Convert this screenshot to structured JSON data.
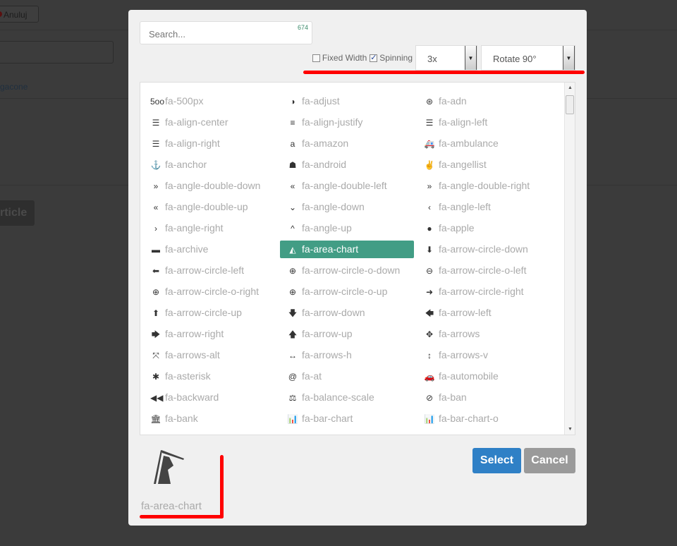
{
  "background": {
    "cancel_label": "Anuluj",
    "link_fragment": "gacone",
    "article_fragment": "rticle"
  },
  "modal": {
    "search": {
      "placeholder": "Search...",
      "count": "674"
    },
    "options": {
      "fixed_width_label": "Fixed Width",
      "fixed_width_checked": false,
      "spinning_label": "Spinning",
      "spinning_checked": true,
      "size_value": "3x",
      "rotate_value": "Rotate 90°"
    },
    "selected": "fa-area-chart",
    "icons": [
      {
        "glyph": "5oo",
        "label": "fa-500px"
      },
      {
        "glyph": "◑",
        "label": "fa-adjust"
      },
      {
        "glyph": "⊛",
        "label": "fa-adn"
      },
      {
        "glyph": "☰",
        "label": "fa-align-center"
      },
      {
        "glyph": "≡",
        "label": "fa-align-justify"
      },
      {
        "glyph": "☰",
        "label": "fa-align-left"
      },
      {
        "glyph": "☰",
        "label": "fa-align-right"
      },
      {
        "glyph": "a",
        "label": "fa-amazon"
      },
      {
        "glyph": "🚑",
        "label": "fa-ambulance"
      },
      {
        "glyph": "⚓",
        "label": "fa-anchor"
      },
      {
        "glyph": "☗",
        "label": "fa-android"
      },
      {
        "glyph": "✌",
        "label": "fa-angellist"
      },
      {
        "glyph": "»",
        "label": "fa-angle-double-down"
      },
      {
        "glyph": "«",
        "label": "fa-angle-double-left"
      },
      {
        "glyph": "»",
        "label": "fa-angle-double-right"
      },
      {
        "glyph": "«",
        "label": "fa-angle-double-up"
      },
      {
        "glyph": "⌄",
        "label": "fa-angle-down"
      },
      {
        "glyph": "‹",
        "label": "fa-angle-left"
      },
      {
        "glyph": "›",
        "label": "fa-angle-right"
      },
      {
        "glyph": "^",
        "label": "fa-angle-up"
      },
      {
        "glyph": "●",
        "label": "fa-apple"
      },
      {
        "glyph": "▬",
        "label": "fa-archive"
      },
      {
        "glyph": "◭",
        "label": "fa-area-chart"
      },
      {
        "glyph": "⬇",
        "label": "fa-arrow-circle-down"
      },
      {
        "glyph": "⬅",
        "label": "fa-arrow-circle-left"
      },
      {
        "glyph": "⊕",
        "label": "fa-arrow-circle-o-down"
      },
      {
        "glyph": "⊖",
        "label": "fa-arrow-circle-o-left"
      },
      {
        "glyph": "⊕",
        "label": "fa-arrow-circle-o-right"
      },
      {
        "glyph": "⊕",
        "label": "fa-arrow-circle-o-up"
      },
      {
        "glyph": "➜",
        "label": "fa-arrow-circle-right"
      },
      {
        "glyph": "⬆",
        "label": "fa-arrow-circle-up"
      },
      {
        "glyph": "🡇",
        "label": "fa-arrow-down"
      },
      {
        "glyph": "🡄",
        "label": "fa-arrow-left"
      },
      {
        "glyph": "🡆",
        "label": "fa-arrow-right"
      },
      {
        "glyph": "🡅",
        "label": "fa-arrow-up"
      },
      {
        "glyph": "✥",
        "label": "fa-arrows"
      },
      {
        "glyph": "⤧",
        "label": "fa-arrows-alt"
      },
      {
        "glyph": "↔",
        "label": "fa-arrows-h"
      },
      {
        "glyph": "↕",
        "label": "fa-arrows-v"
      },
      {
        "glyph": "✱",
        "label": "fa-asterisk"
      },
      {
        "glyph": "@",
        "label": "fa-at"
      },
      {
        "glyph": "🚗",
        "label": "fa-automobile"
      },
      {
        "glyph": "◀◀",
        "label": "fa-backward"
      },
      {
        "glyph": "⚖",
        "label": "fa-balance-scale"
      },
      {
        "glyph": "⊘",
        "label": "fa-ban"
      },
      {
        "glyph": "🏛",
        "label": "fa-bank"
      },
      {
        "glyph": "📊",
        "label": "fa-bar-chart"
      },
      {
        "glyph": "📊",
        "label": "fa-bar-chart-o"
      }
    ],
    "select_label": "Select",
    "cancel_label": "Cancel",
    "colors": {
      "accent": "#429d85",
      "select": "#2f80c6",
      "cancel": "#9a9a9a",
      "annotation": "#ff0000"
    }
  }
}
